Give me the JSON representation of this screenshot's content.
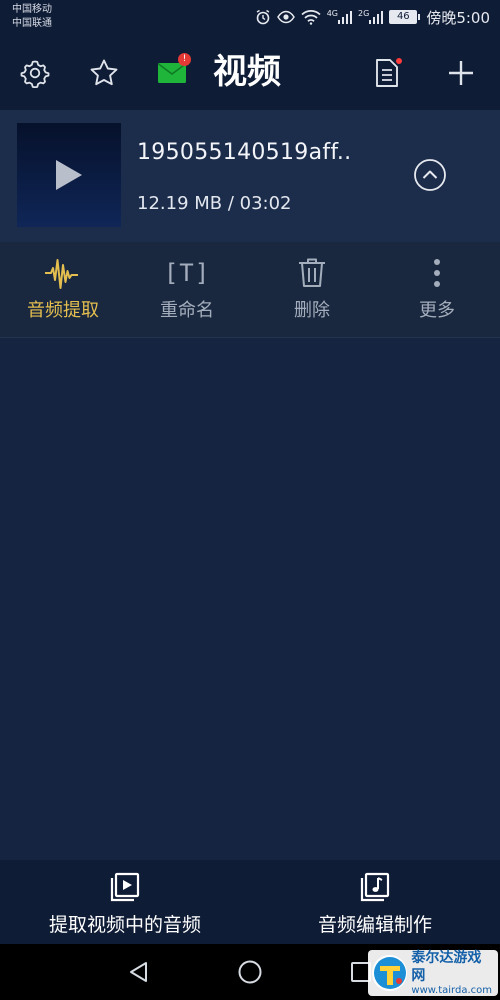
{
  "status_bar": {
    "carrier_1": "中国移动",
    "carrier_2": "中国联通",
    "network_1": "4G",
    "network_2": "2G",
    "battery": "46",
    "time": "傍晚5:00"
  },
  "toolbar": {
    "title": "视频",
    "mail_badge": "!",
    "icons": [
      "gear-icon",
      "star-icon",
      "mail-icon",
      "document-icon",
      "plus-icon"
    ]
  },
  "video": {
    "file_name": "195055140519aff..",
    "size": "12.19 MB",
    "duration": "03:02",
    "meta": "12.19 MB / 03:02"
  },
  "actions": [
    {
      "label": "音频提取",
      "icon": "waveform-icon",
      "active": true
    },
    {
      "label": "重命名",
      "icon": "rename-icon",
      "glyph": "[T]",
      "active": false
    },
    {
      "label": "删除",
      "icon": "trash-icon",
      "active": false
    },
    {
      "label": "更多",
      "icon": "more-vertical-icon",
      "active": false
    }
  ],
  "bottom_bar": {
    "extract_label": "提取视频中的音频",
    "edit_label": "音频编辑制作"
  },
  "watermark": {
    "name": "泰尔达游戏网",
    "url": "www.tairda.com"
  },
  "colors": {
    "background": "#152440",
    "toolbar": "#0f1c36",
    "accent": "#e4be4f",
    "muted": "#a4adbc"
  }
}
